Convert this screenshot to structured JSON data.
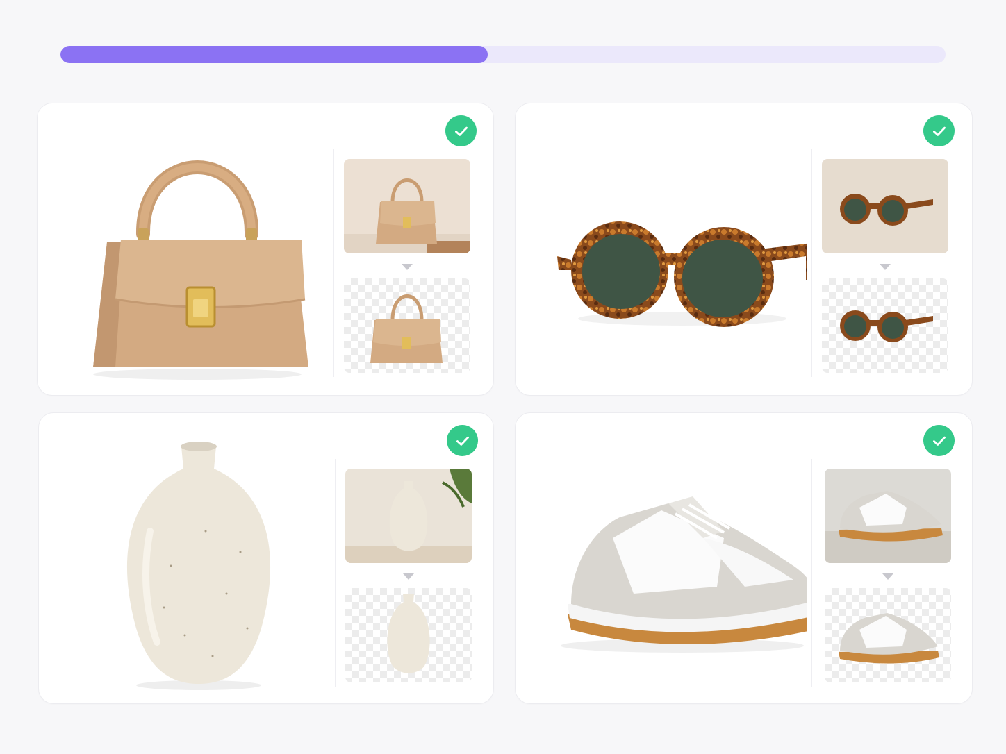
{
  "progress": {
    "fraction": 0.483,
    "fill_color": "#8b72f3",
    "track_color": "#ebe8fb"
  },
  "status_color": "#34c98a",
  "products": [
    {
      "subject": "handbag",
      "status_icon": "check-icon",
      "transform_icon": "arrow-down-icon",
      "background_removed": true
    },
    {
      "subject": "sunglasses",
      "status_icon": "check-icon",
      "transform_icon": "arrow-down-icon",
      "background_removed": true
    },
    {
      "subject": "vase",
      "status_icon": "check-icon",
      "transform_icon": "arrow-down-icon",
      "background_removed": true
    },
    {
      "subject": "sneaker",
      "status_icon": "check-icon",
      "transform_icon": "arrow-down-icon",
      "background_removed": true
    }
  ]
}
